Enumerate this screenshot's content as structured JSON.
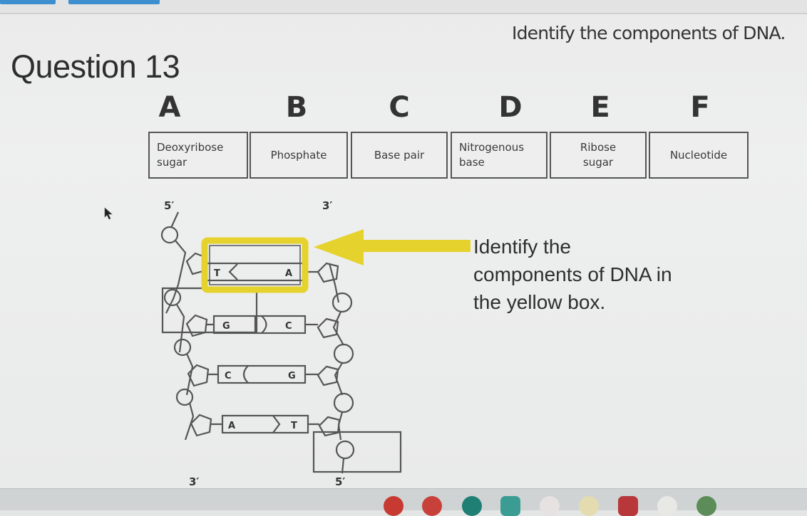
{
  "header": {
    "prompt": "Identify the components of DNA.",
    "question_title": "Question 13"
  },
  "options": [
    {
      "letter": "A",
      "label": "Deoxyribose sugar",
      "line1": "Deoxyribose",
      "line2": "sugar"
    },
    {
      "letter": "B",
      "label": "Phosphate",
      "line1": "Phosphate",
      "line2": ""
    },
    {
      "letter": "C",
      "label": "Base pair",
      "line1": "Base pair",
      "line2": ""
    },
    {
      "letter": "D",
      "label": "Nitrogenous base",
      "line1": "Nitrogenous",
      "line2": "base"
    },
    {
      "letter": "E",
      "label": "Ribose sugar",
      "line1": "Ribose",
      "line2": "sugar"
    },
    {
      "letter": "F",
      "label": "Nucleotide",
      "line1": "Nucleotide",
      "line2": ""
    }
  ],
  "diagram": {
    "left_top_label": "5′",
    "right_top_label": "3′",
    "left_bottom_label": "3′",
    "right_bottom_label": "5′",
    "base_pairs": [
      {
        "left": "T",
        "right": "A",
        "highlighted": true
      },
      {
        "left": "G",
        "right": "C",
        "highlighted": false
      },
      {
        "left": "C",
        "right": "G",
        "highlighted": false
      },
      {
        "left": "A",
        "right": "T",
        "highlighted": false
      }
    ],
    "highlight_color": "#e8d630"
  },
  "instruction": {
    "line1": "Identify the",
    "line2": "components of DNA in",
    "line3": "the yellow box."
  },
  "taskbar": {
    "icons": [
      {
        "name": "app-icon-1",
        "color": "#c63a32"
      },
      {
        "name": "app-icon-2",
        "color": "#c8403a"
      },
      {
        "name": "app-icon-3",
        "color": "#1f7f74"
      },
      {
        "name": "app-icon-4",
        "color": "#3a9c93"
      },
      {
        "name": "app-icon-5",
        "color": "#e6e2e2"
      },
      {
        "name": "app-icon-6",
        "color": "#e4dcb0"
      },
      {
        "name": "app-icon-7",
        "color": "#b8373a"
      },
      {
        "name": "app-icon-8",
        "color": "#e8e8e4"
      },
      {
        "name": "app-icon-9",
        "color": "#5c8c58"
      }
    ]
  }
}
